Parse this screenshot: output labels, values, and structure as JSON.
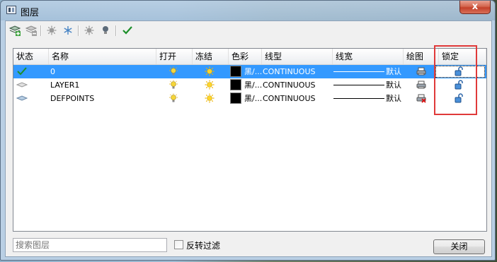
{
  "window": {
    "title": "图层",
    "close_glyph": "x"
  },
  "toolbar": {
    "buttons": [
      {
        "name": "new-layer-icon"
      },
      {
        "name": "delete-layer-icon"
      },
      {
        "name": "freeze-all-icon"
      },
      {
        "name": "thaw-icon"
      },
      {
        "name": "isolate-icon"
      },
      {
        "name": "light-bulb-icon"
      },
      {
        "name": "set-current-check-icon"
      }
    ]
  },
  "grid": {
    "columns": [
      "状态",
      "名称",
      "打开",
      "冻结",
      "色彩",
      "线型",
      "线宽",
      "绘图",
      "锁定"
    ],
    "rows": [
      {
        "status": "current-check",
        "name": "0",
        "color_label": "黑/...",
        "linetype": "CONTINUOUS",
        "lineweight": "默认",
        "plot": "printer",
        "lock": "unlocked",
        "selected": true
      },
      {
        "status": "layer",
        "name": "LAYER1",
        "color_label": "黑/...",
        "linetype": "CONTINUOUS",
        "lineweight": "默认",
        "plot": "printer",
        "lock": "unlocked",
        "selected": false
      },
      {
        "status": "layer",
        "name": "DEFPOINTS",
        "color_label": "黑/...",
        "linetype": "CONTINUOUS",
        "lineweight": "默认",
        "plot": "no-print",
        "lock": "unlocked",
        "selected": false
      }
    ]
  },
  "footer": {
    "search_placeholder": "搜索图层",
    "invert_filter_label": "反转过滤",
    "close_button": "关闭"
  },
  "colors": {
    "selection": "#3399ff",
    "highlight_box": "#e03a3a",
    "layer_color": "#000000"
  }
}
